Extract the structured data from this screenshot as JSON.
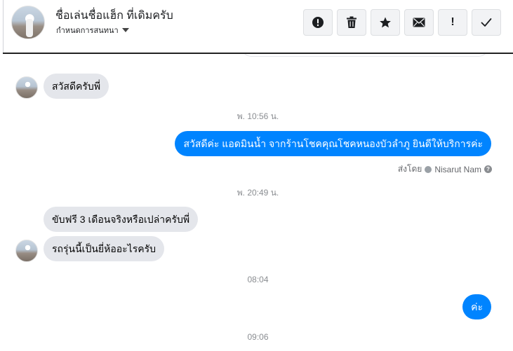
{
  "header": {
    "name": "ชื่อเล่นชื่อแฮ็ก ที่เดิมครับ",
    "subtitle": "กำหนดการสนทนา",
    "toolbar": [
      {
        "icon": "alert-circle-icon"
      },
      {
        "icon": "trash-icon"
      },
      {
        "icon": "star-icon"
      },
      {
        "icon": "envelope-icon"
      },
      {
        "icon": "exclamation-icon",
        "glyph": "!"
      },
      {
        "icon": "checkmark-icon"
      }
    ]
  },
  "messages": {
    "m1": "สวัสดีครับพี่",
    "ts1": "พ. 10:56 น.",
    "m2": "สวัสดีค่ะ แอดมินน้ำ จากร้านโชคคุณโชคหนองบัวลำภู ยินดีให้บริการค่ะ",
    "sent_by_label": "ส่งโดย",
    "sent_by_name": "Nisarut Nam",
    "sent_by_help": "?",
    "ts2": "พ. 20:49 น.",
    "m3": "ขับฟรี 3 เดือนจริงหรือเปล่าครับพี่",
    "m4": "รถรุ่นนี้เป็นยี่ห้ออะไรครับ",
    "ts3": "08:04",
    "m5": "ค่ะ",
    "ts4": "09:06"
  },
  "colors": {
    "outgoing_bubble": "#0084ff",
    "incoming_bubble": "#e4e6eb",
    "timestamp": "#8a8d91"
  }
}
